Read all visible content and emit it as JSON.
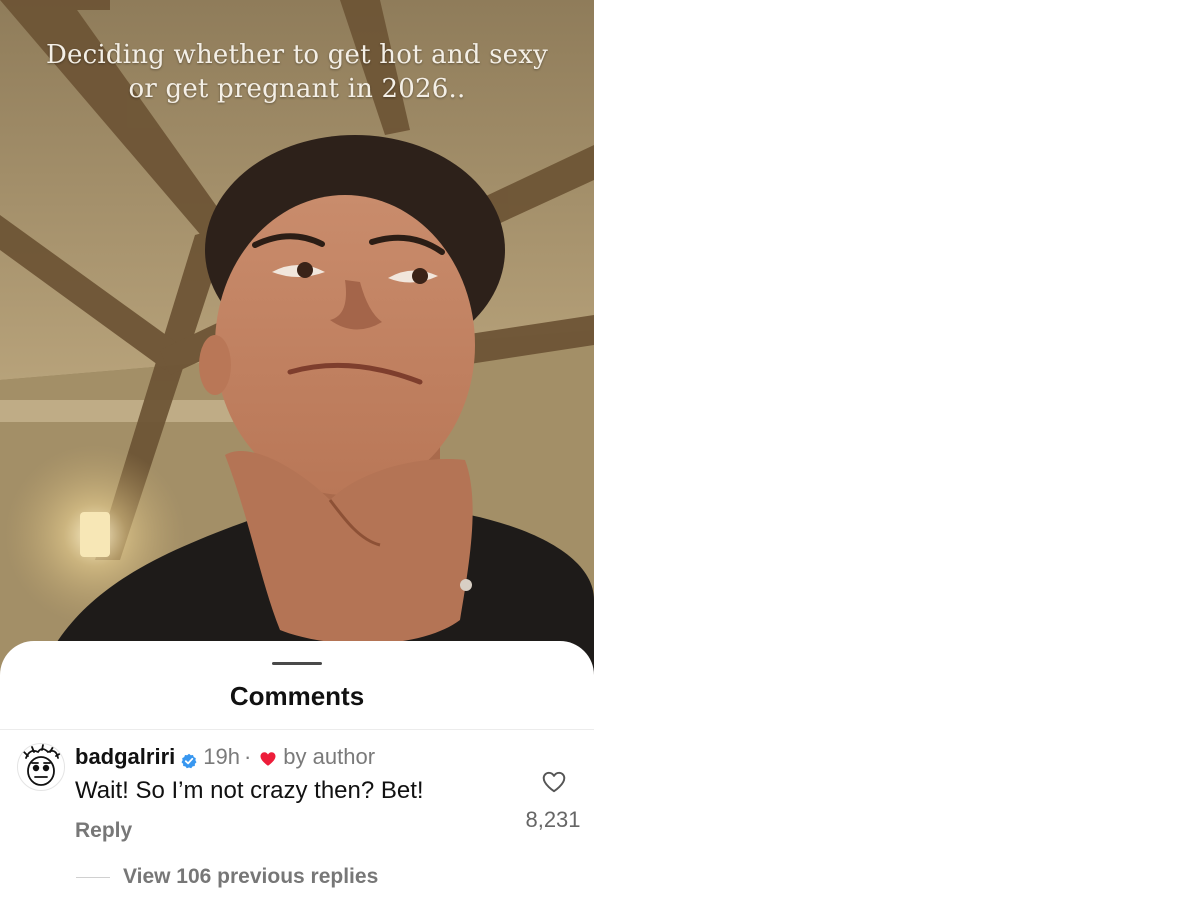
{
  "video": {
    "caption": "Deciding whether to get hot and sexy or get pregnant in 2026.."
  },
  "comments_sheet": {
    "title": "Comments",
    "comment": {
      "username": "badgalriri",
      "verified_icon": "verified-badge-icon",
      "time": "19h",
      "separator": "·",
      "liked_by_author_icon": "heart-icon",
      "liked_by_author_label": "by author",
      "text": "Wait! So I’m not crazy then? Bet!",
      "reply_label": "Reply",
      "like_icon": "heart-outline-icon",
      "like_count": "8,231"
    },
    "view_replies_label": "View 106 previous replies"
  },
  "colors": {
    "verified_blue": "#3897f0",
    "heart_red": "#ed1d3a",
    "muted_text": "#7a7a7a"
  }
}
